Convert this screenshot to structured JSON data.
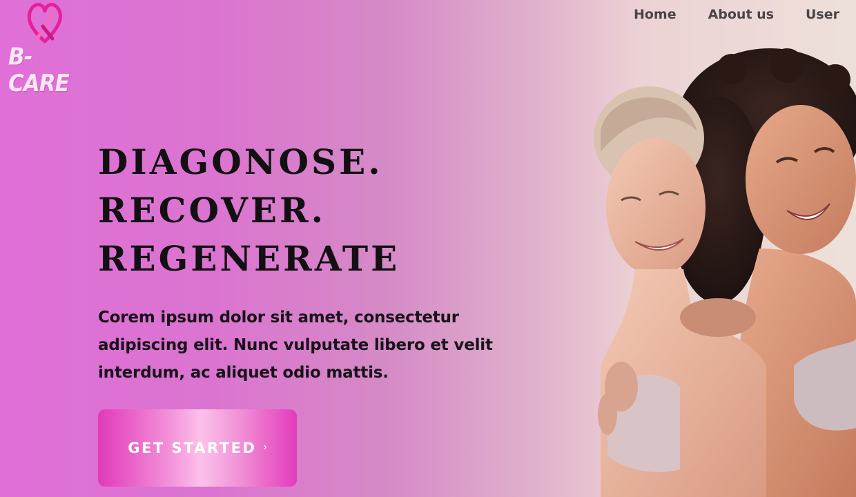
{
  "brand": {
    "name": "B-CARE",
    "logo_icon": "heart-ribbon-icon",
    "accent_color": "#e13ab9"
  },
  "nav": {
    "items": [
      {
        "label": "Home"
      },
      {
        "label": "About us"
      },
      {
        "label": "User"
      }
    ]
  },
  "hero": {
    "headline": [
      "DIAGONOSE.",
      "RECOVER.",
      "REGENERATE"
    ],
    "description": "Corem ipsum dolor sit amet, consectetur adipiscing elit. Nunc vulputate libero et velit interdum, ac aliquet odio mattis.",
    "cta_label": "GET STARTED",
    "cta_icon": "chevron-right-icon",
    "image": "two-smiling-women-photo"
  },
  "colors": {
    "background_start": "#e070d8",
    "background_end": "#ede0da",
    "text_dark": "#121012"
  }
}
